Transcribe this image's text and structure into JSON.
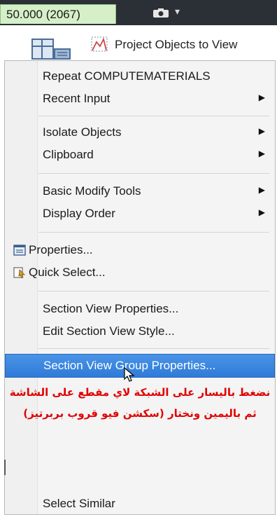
{
  "ribbon": {
    "tab_label": "50.000 (2067)",
    "camera_icon": "camera-icon",
    "dropdown_arrow": "▾"
  },
  "toolbar": {
    "app_icon": "layout-grid-icon",
    "project_objects_icon": "profile-view-icon",
    "project_objects_label": "Project Objects to View"
  },
  "menu": {
    "items": [
      {
        "label": "Repeat COMPUTEMATERIALS",
        "submenu": false
      },
      {
        "label": "Recent Input",
        "submenu": true
      },
      {
        "label": "Isolate Objects",
        "submenu": true
      },
      {
        "label": "Clipboard",
        "submenu": true
      },
      {
        "label": "Basic Modify Tools",
        "submenu": true
      },
      {
        "label": "Display Order",
        "submenu": true
      },
      {
        "label": "Properties...",
        "icon": "properties-icon",
        "submenu": false
      },
      {
        "label": "Quick Select...",
        "icon": "quick-select-icon",
        "submenu": false
      },
      {
        "label": "Section View Properties...",
        "submenu": false
      },
      {
        "label": "Edit Section View Style...",
        "submenu": false
      },
      {
        "label": "Section View Group Properties...",
        "submenu": false,
        "highlighted": true
      },
      {
        "label": "Select Similar",
        "submenu": false
      }
    ],
    "submenu_arrow": "▶",
    "highlight_color": "#3b86e0"
  },
  "annotation": {
    "line1": "نضغط باليسار على الشبكة لاي مقطع على الشاشة",
    "line2": "ثم باليمين ونختار (سكشن فيو قروب بربرتيز)",
    "color": "#e00000"
  }
}
